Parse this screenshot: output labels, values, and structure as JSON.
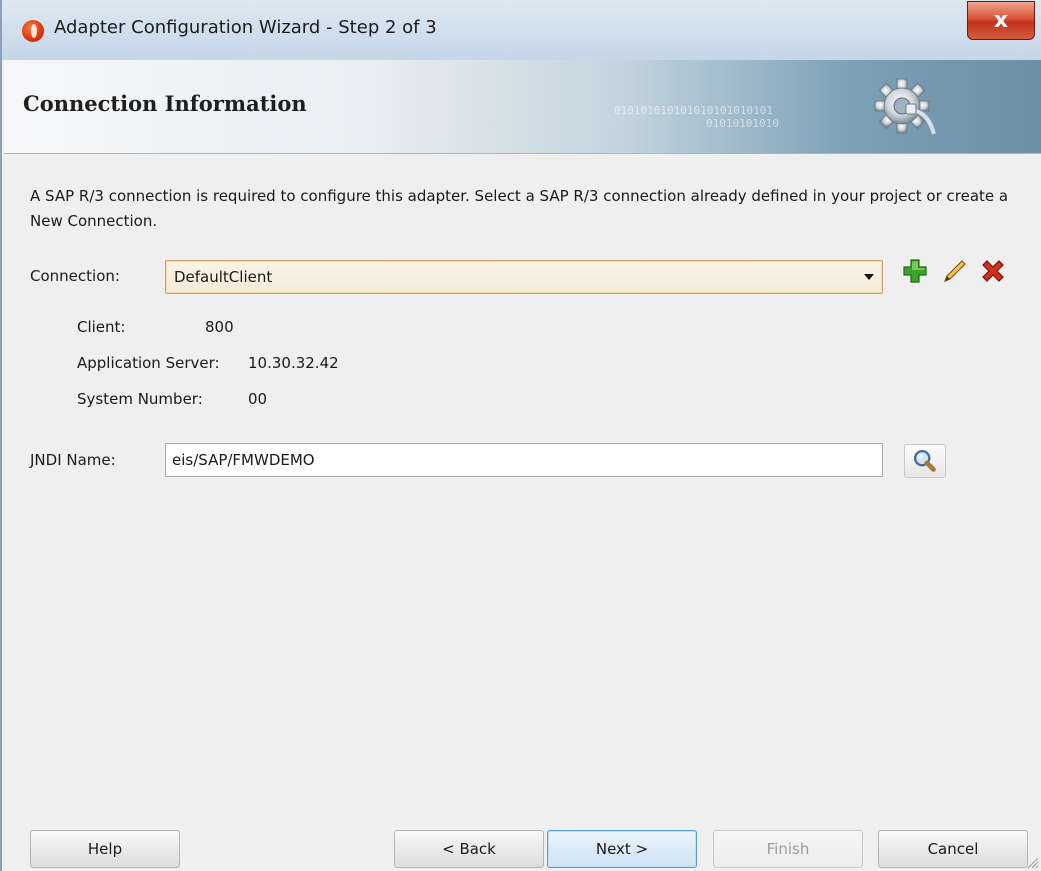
{
  "window": {
    "title": "Adapter Configuration Wizard - Step 2 of 3",
    "close_label": "x"
  },
  "banner": {
    "heading": "Connection Information",
    "binary_text": "010101010101010101010101\n01010101010"
  },
  "description": "A SAP R/3 connection is required to configure this adapter. Select a SAP R/3 connection already defined in your project or create a New Connection.",
  "connection": {
    "label": "Connection:",
    "selected": "DefaultClient"
  },
  "details": {
    "client_label": "Client:",
    "client_value": "800",
    "app_server_label": "Application Server:",
    "app_server_value": "10.30.32.42",
    "system_number_label": "System Number:",
    "system_number_value": "00"
  },
  "jndi": {
    "label": "JNDI Name:",
    "value": "eis/SAP/FMWDEMO"
  },
  "buttons": {
    "help": "Help",
    "back": "< Back",
    "next": "Next >",
    "finish": "Finish",
    "cancel": "Cancel"
  },
  "icons": {
    "add": "add-plus-icon",
    "edit": "edit-pencil-icon",
    "delete": "delete-x-icon",
    "search": "magnifier-icon",
    "banner": "gear-plug-icon"
  },
  "colors": {
    "add": "#3aa52a",
    "delete": "#d0311f",
    "combo_border": "#c9a36b",
    "next_border": "#5a9ad5"
  }
}
